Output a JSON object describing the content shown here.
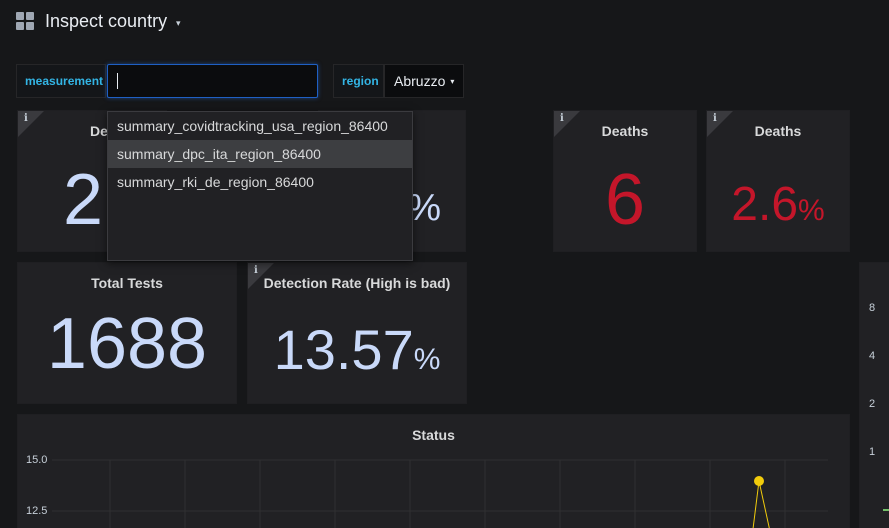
{
  "header": {
    "title": "Inspect country",
    "title_caret": "▾"
  },
  "variables": {
    "measurement": {
      "label": "measurement",
      "value": ""
    },
    "region": {
      "label": "region",
      "value": "Abruzzo",
      "caret": "▾"
    }
  },
  "dropdown": {
    "options": [
      "summary_covidtracking_usa_region_86400",
      "summary_dpc_ita_region_86400",
      "summary_rki_de_region_86400"
    ],
    "highlighted_index": 1
  },
  "panels": {
    "p1": {
      "title": "De",
      "value": "2",
      "info": "i"
    },
    "p2": {
      "unit": "%"
    },
    "deaths_abs": {
      "title": "Deaths",
      "value": "6",
      "info": "i",
      "color": "#c4162a"
    },
    "deaths_pct": {
      "title": "Deaths",
      "value": "2.6",
      "unit": "%",
      "info": "i",
      "color": "#c4162a"
    },
    "total_tests": {
      "title": "Total Tests",
      "value": "1688"
    },
    "detection_rate": {
      "title": "Detection Rate (High is bad)",
      "value": "13.57",
      "unit": "%",
      "info": "i"
    }
  },
  "status_chart": {
    "title": "Status",
    "y_ticks": [
      "15.0",
      "12.5"
    ],
    "marker_color": "#f2cc0c"
  },
  "right_panel": {
    "y_ticks": [
      "8",
      "4",
      "2",
      "1"
    ],
    "series_color": "#73bf69"
  },
  "colors": {
    "accent_label": "#33b5e5",
    "stat_blue": "#c9d9f9",
    "death_red": "#c4162a"
  }
}
